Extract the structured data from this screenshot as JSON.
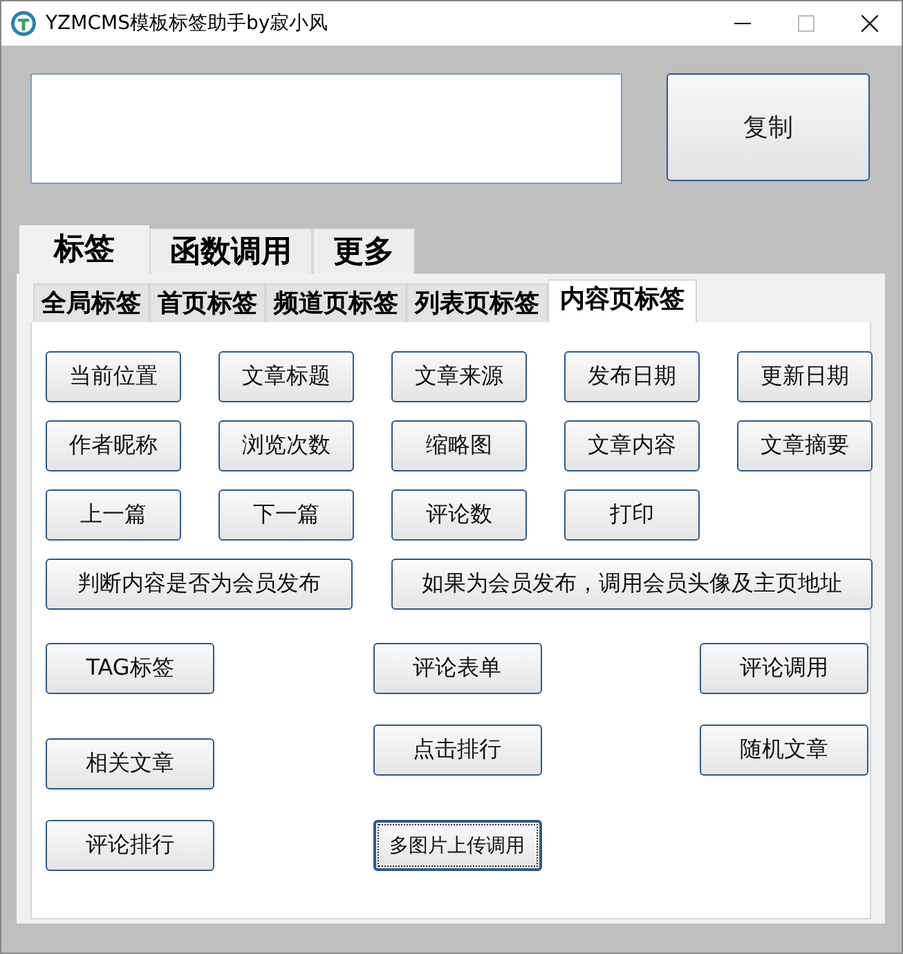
{
  "window": {
    "title": "YZMCMS模板标签助手by寂小风"
  },
  "copy_button": "复制",
  "tabs": [
    {
      "label": "标签",
      "selected": true
    },
    {
      "label": "函数调用",
      "selected": false
    },
    {
      "label": "更多",
      "selected": false
    }
  ],
  "subtabs": [
    {
      "label": "全局标签",
      "selected": false
    },
    {
      "label": "首页标签",
      "selected": false
    },
    {
      "label": "频道页标签",
      "selected": false
    },
    {
      "label": "列表页标签",
      "selected": false
    },
    {
      "label": "内容页标签",
      "selected": true
    }
  ],
  "button_rows": [
    {
      "kind": "grid5",
      "buttons": [
        {
          "label": "当前位置",
          "focused": false
        },
        {
          "label": "文章标题",
          "focused": false
        },
        {
          "label": "文章来源",
          "focused": false
        },
        {
          "label": "发布日期",
          "focused": false
        },
        {
          "label": "更新日期",
          "focused": false
        }
      ]
    },
    {
      "kind": "grid5",
      "buttons": [
        {
          "label": "作者昵称",
          "focused": false
        },
        {
          "label": "浏览次数",
          "focused": false
        },
        {
          "label": "缩略图",
          "focused": false
        },
        {
          "label": "文章内容",
          "focused": false
        },
        {
          "label": "文章摘要",
          "focused": false
        }
      ]
    },
    {
      "kind": "grid5",
      "buttons": [
        {
          "label": "上一篇",
          "focused": false
        },
        {
          "label": "下一篇",
          "focused": false
        },
        {
          "label": "评论数",
          "focused": false
        },
        {
          "label": "打印",
          "focused": false
        }
      ]
    },
    {
      "kind": "wide",
      "buttons": [
        {
          "label": "判断内容是否为会员发布",
          "focused": false
        },
        {
          "label": "如果为会员发布，调用会员头像及主页地址",
          "focused": false
        }
      ]
    },
    {
      "kind": "grid3",
      "buttons": [
        {
          "label": "TAG标签",
          "focused": false
        },
        {
          "label": "评论表单",
          "focused": false
        },
        {
          "label": "评论调用",
          "focused": false
        }
      ]
    },
    {
      "kind": "grid3",
      "buttons": [
        {
          "label": "相关文章",
          "focused": false
        },
        {
          "label": "点击排行",
          "focused": false
        },
        {
          "label": "随机文章",
          "focused": false
        }
      ]
    },
    {
      "kind": "grid3",
      "buttons": [
        {
          "label": "评论排行",
          "focused": false
        },
        {
          "label": "多图片上传调用",
          "focused": true
        }
      ]
    }
  ]
}
